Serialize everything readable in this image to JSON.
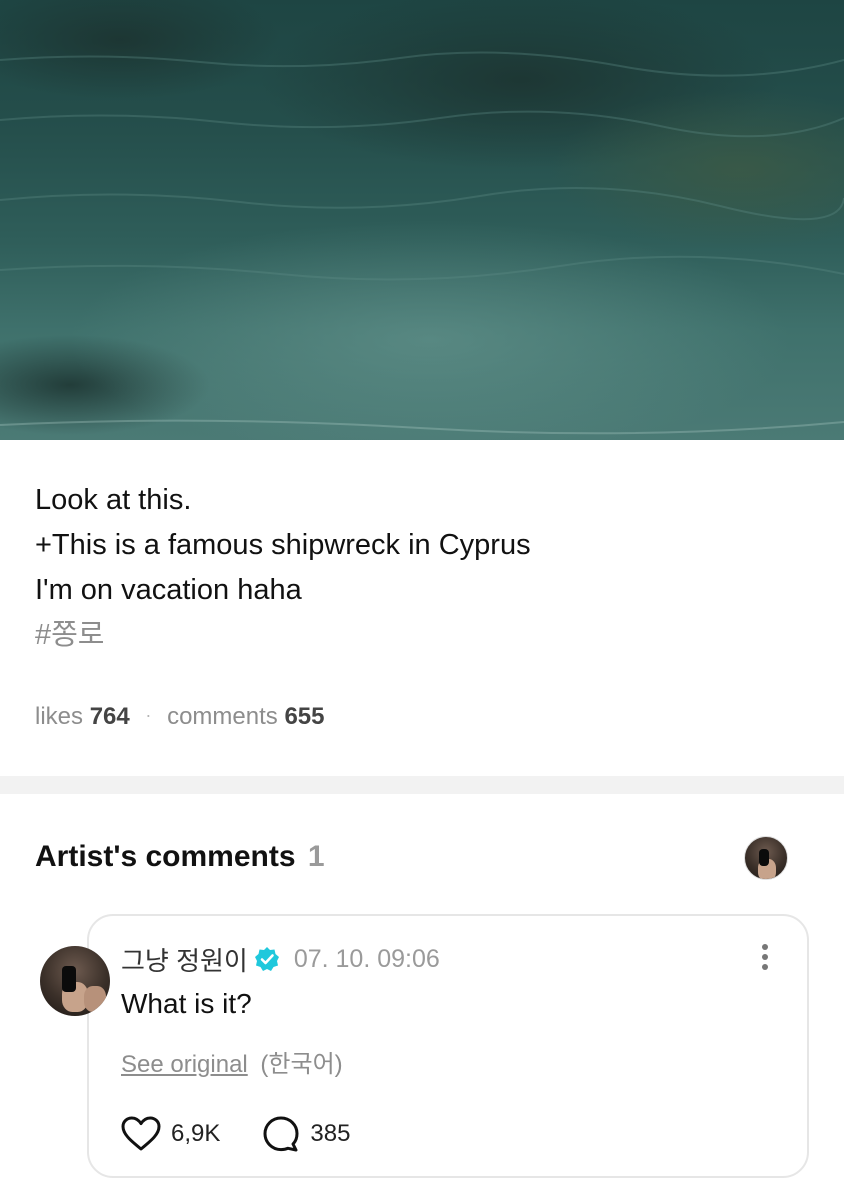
{
  "post": {
    "photo_alt": "photo",
    "caption_lines": [
      "Look at this.",
      "+This is a famous shipwreck in Cyprus",
      "I'm on vacation haha"
    ],
    "hashtag": "#쫑로",
    "likes_label": "likes",
    "likes_count": "764",
    "separator": "·",
    "comments_label": "comments",
    "comments_count": "655"
  },
  "artist_comments": {
    "title": "Artist's comments",
    "count": "1",
    "comments": [
      {
        "author": "그냥 정원이",
        "verified_icon": "verified-badge-icon",
        "timestamp": "07. 10. 09:06",
        "text": "What is it?",
        "see_original": "See original",
        "original_language": "(한국어)",
        "likes": "6,9K",
        "replies": "385"
      }
    ]
  },
  "colors": {
    "muted_text": "#8d8d8d",
    "verified_badge": "#1fc8dc",
    "card_border": "#e6e6e6",
    "divider": "#f2f2f2"
  }
}
